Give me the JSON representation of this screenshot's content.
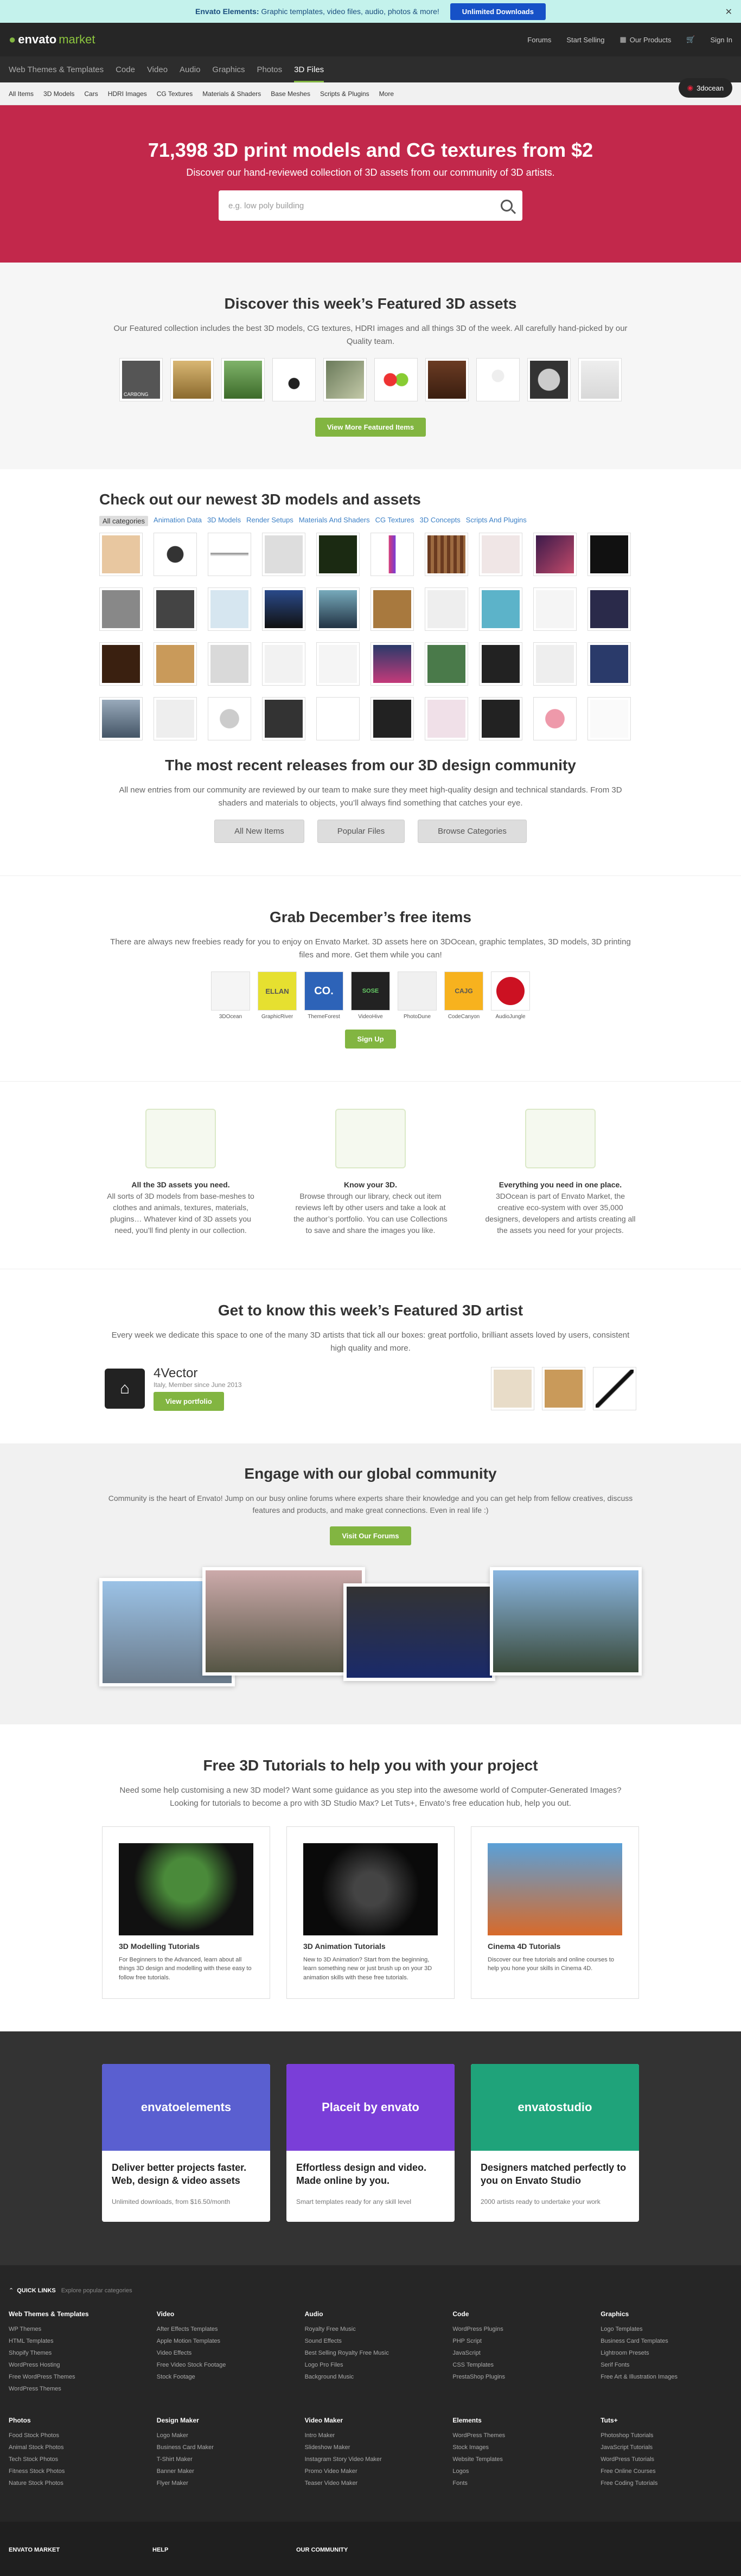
{
  "promo": {
    "brand": "Envato Elements:",
    "text": "Graphic templates, video files, audio, photos & more!",
    "cta": "Unlimited Downloads"
  },
  "header": {
    "logo_a": "envato",
    "logo_b": "market",
    "links": [
      "Forums",
      "Start Selling",
      "Our Products",
      "Sign In"
    ]
  },
  "catnav": {
    "items": [
      "Web Themes & Templates",
      "Code",
      "Video",
      "Audio",
      "Graphics",
      "Photos",
      "3D Files"
    ],
    "badge": "3docean"
  },
  "subnav": [
    "All Items",
    "3D Models",
    "Cars",
    "HDRI Images",
    "CG Textures",
    "Materials & Shaders",
    "Base Meshes",
    "Scripts & Plugins",
    "More"
  ],
  "hero": {
    "title": "71,398 3D print models and CG textures from $2",
    "subtitle": "Discover our hand-reviewed collection of 3D assets from our community of 3D artists.",
    "placeholder": "e.g. low poly building"
  },
  "featured": {
    "title": "Discover this week’s Featured 3D assets",
    "lead": "Our Featured collection includes the best 3D models, CG textures, HDRI images and all things 3D of the week. All carefully hand-picked by our Quality team.",
    "thumb_text": "CARBONG",
    "button": "View More Featured Items"
  },
  "newest": {
    "title": "Check out our newest 3D models and assets",
    "filters": [
      "All categories",
      "Animation Data",
      "3D Models",
      "Render Setups",
      "Materials And Shaders",
      "CG Textures",
      "3D Concepts",
      "Scripts And Plugins"
    ]
  },
  "recent": {
    "title": "The most recent releases from our 3D design community",
    "lead": "All new entries from our community are reviewed by our team to make sure they meet high-quality design and technical standards. From 3D shaders and materials to objects, you’ll always find something that catches your eye.",
    "buttons": [
      "All New Items",
      "Popular Files",
      "Browse Categories"
    ]
  },
  "free": {
    "title": "Grab December’s free items",
    "lead": "There are always new freebies ready for you to enjoy on Envato Market. 3D assets here on 3DOcean, graphic templates, 3D models, 3D printing files and more. Get them while you can!",
    "items": [
      {
        "name": "3DOcean",
        "label": ""
      },
      {
        "name": "GraphicRiver",
        "label": "ELLAN"
      },
      {
        "name": "ThemeForest",
        "label": "CO."
      },
      {
        "name": "VideoHive",
        "label": "SOSE"
      },
      {
        "name": "PhotoDune",
        "label": ""
      },
      {
        "name": "CodeCanyon",
        "label": "CAJG"
      },
      {
        "name": "AudioJungle",
        "label": ""
      }
    ],
    "button": "Sign Up"
  },
  "features": [
    {
      "title": "All the 3D assets you need.",
      "text": "All sorts of 3D models from base-meshes to clothes and animals, textures, materials, plugins… Whatever kind of 3D assets you need, you’ll find plenty in our collection."
    },
    {
      "title": "Know your 3D.",
      "text": "Browse through our library, check out item reviews left by other users and take a look at the author’s portfolio. You can use Collections to save and share the images you like."
    },
    {
      "title": "Everything you need in one place.",
      "text": "3DOcean is part of Envato Market, the creative eco-system with over 35,000 designers, developers and artists creating all the assets you need for your projects."
    }
  ],
  "artist": {
    "title": "Get to know this week’s Featured 3D artist",
    "lead": "Every week we dedicate this space to one of the many 3D artists that tick all our boxes: great portfolio, brilliant assets loved by users, consistent high quality and more.",
    "name": "4Vector",
    "meta": "Italy, Member since June 2013",
    "button": "View portfolio"
  },
  "community": {
    "title": "Engage with our global community",
    "lead": "Community is the heart of Envato! Jump on our busy online forums where experts share their knowledge and you can get help from fellow creatives, discuss features and products, and make great connections. Even in real life :)",
    "button": "Visit Our Forums"
  },
  "tutorials": {
    "title": "Free 3D Tutorials to help you with your project",
    "lead": "Need some help customising a new 3D model? Want some guidance as you step into the awesome world of Computer-Generated Images? Looking for tutorials to become a pro with 3D Studio Max? Let Tuts+, Envato’s free education hub, help you out.",
    "cards": [
      {
        "title": "3D Modelling Tutorials",
        "text": "For Beginners to the Advanced, learn about all things 3D design and modelling with these easy to follow free tutorials."
      },
      {
        "title": "3D Animation Tutorials",
        "text": "New to 3D Animation? Start from the beginning, learn something new or just brush up on your 3D animation skills with these free tutorials."
      },
      {
        "title": "Cinema 4D Tutorials",
        "text": "Discover our free tutorials and online courses to help you hone your skills in Cinema 4D."
      }
    ]
  },
  "promos": [
    {
      "brand": "envatoelements",
      "title": "Deliver better projects faster. Web, design & video assets",
      "text": "Unlimited downloads, from $16.50/month",
      "color": "#5a5fd0"
    },
    {
      "brand": "Placeit by envato",
      "title": "Effortless design and video. Made online by you.",
      "text": "Smart templates ready for any skill level",
      "color": "#7a3ed8"
    },
    {
      "brand": "envatostudio",
      "title": "Designers matched perfectly to you on Envato Studio",
      "text": "2000 artists ready to undertake your work",
      "color": "#1fa37a"
    }
  ],
  "quick": {
    "title": "QUICK LINKS",
    "sub": "Explore popular categories",
    "cols": [
      {
        "h": "Web Themes & Templates",
        "l": [
          "WP Themes",
          "HTML Templates",
          "Shopify Themes",
          "WordPress Hosting",
          "Free WordPress Themes",
          "WordPress Themes"
        ]
      },
      {
        "h": "Video",
        "l": [
          "After Effects Templates",
          "Apple Motion Templates",
          "Video Effects",
          "Free Video Stock Footage",
          "Stock Footage"
        ]
      },
      {
        "h": "Audio",
        "l": [
          "Royalty Free Music",
          "Sound Effects",
          "Best Selling Royalty Free Music",
          "Logo Pro Files",
          "Background Music"
        ]
      },
      {
        "h": "Code",
        "l": [
          "WordPress Plugins",
          "PHP Script",
          "JavaScript",
          "CSS Templates",
          "PrestaShop Plugins"
        ]
      },
      {
        "h": "Graphics",
        "l": [
          "Logo Templates",
          "Business Card Templates",
          "Lightroom Presets",
          "Serif Fonts",
          "Free Art & Illustration Images"
        ]
      },
      {
        "h": "Photos",
        "l": [
          "Food Stock Photos",
          "Animal Stock Photos",
          "Tech Stock Photos",
          "Fitness Stock Photos",
          "Nature Stock Photos"
        ]
      },
      {
        "h": "Design Maker",
        "l": [
          "Logo Maker",
          "Business Card Maker",
          "T-Shirt Maker",
          "Banner Maker",
          "Flyer Maker"
        ]
      },
      {
        "h": "Video Maker",
        "l": [
          "Intro Maker",
          "Slideshow Maker",
          "Instagram Story Video Maker",
          "Promo Video Maker",
          "Teaser Video Maker"
        ]
      },
      {
        "h": "Elements",
        "l": [
          "WordPress Themes",
          "Stock Images",
          "Website Templates",
          "Logos",
          "Fonts"
        ]
      },
      {
        "h": "Tuts+",
        "l": [
          "Photoshop Tutorials",
          "JavaScript Tutorials",
          "WordPress Tutorials",
          "Free Online Courses",
          "Free Coding Tutorials"
        ]
      }
    ]
  },
  "footer": [
    "ENVATO MARKET",
    "HELP",
    "OUR COMMUNITY"
  ]
}
